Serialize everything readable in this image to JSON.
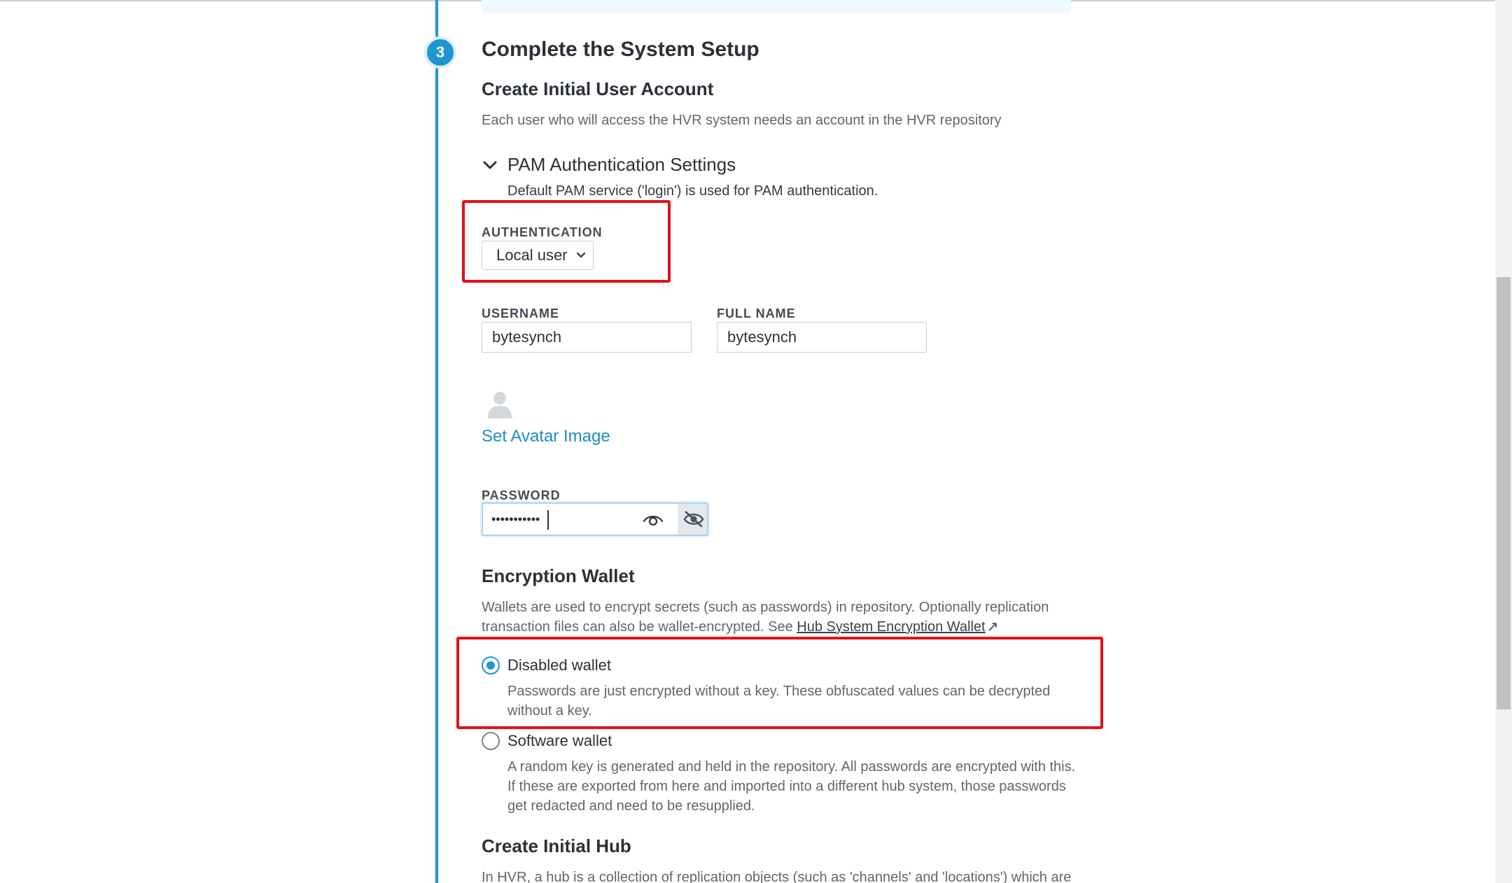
{
  "step": {
    "number": "3",
    "title": "Complete the System Setup"
  },
  "user_account": {
    "heading": "Create Initial User Account",
    "description": "Each user who will access the HVR system needs an account in the HVR repository"
  },
  "pam": {
    "title": "PAM Authentication Settings",
    "description": "Default PAM service ('login') is used for PAM authentication."
  },
  "authentication": {
    "label": "AUTHENTICATION",
    "selected": "Local user"
  },
  "username": {
    "label": "USERNAME",
    "value": "bytesynch"
  },
  "full_name": {
    "label": "FULL NAME",
    "value": "bytesynch"
  },
  "avatar": {
    "link": "Set Avatar Image"
  },
  "password": {
    "label": "PASSWORD",
    "masked_value": "•••••••••••"
  },
  "wallet": {
    "heading": "Encryption Wallet",
    "description_line1": "Wallets are used to encrypt secrets (such as passwords) in repository. Optionally replication",
    "description_line2": "transaction files can also be wallet-encrypted. See ",
    "link": "Hub System Encryption Wallet",
    "link_icon": "↗",
    "options": [
      {
        "label": "Disabled wallet",
        "description_line1": "Passwords are just encrypted without a key. These obfuscated values can be decrypted",
        "description_line2": "without a key.",
        "selected": true
      },
      {
        "label": "Software wallet",
        "description_line1": "A random key is generated and held in the repository. All passwords are encrypted with this.",
        "description_line2": "If these are exported from here and imported into a different hub system, those passwords",
        "description_line3": "get redacted and need to be resupplied.",
        "selected": false
      }
    ]
  },
  "hub": {
    "heading": "Create Initial Hub",
    "description": "In HVR, a hub is a collection of replication objects (such as 'channels' and 'locations') which are"
  },
  "colors": {
    "accent": "#1f95d1",
    "highlight": "#e5101a"
  }
}
